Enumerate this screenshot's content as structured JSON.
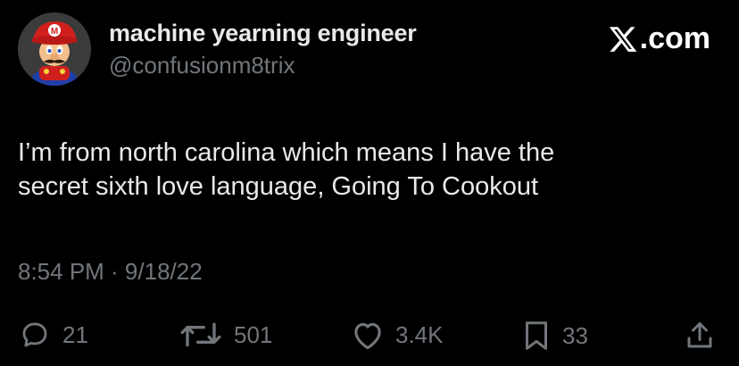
{
  "author": {
    "display_name": "machine yearning engineer",
    "handle": "@confusionm8trix",
    "avatar_icon": "mario-avatar-icon"
  },
  "brand": {
    "label": ".com",
    "icon": "x-logo-icon",
    "color": "#ffffff"
  },
  "tweet": {
    "text_lines": [
      "I’m from north carolina which means I have the",
      "secret sixth love language, Going To Cookout"
    ],
    "timestamp": "8:54 PM · 9/18/22"
  },
  "actions": {
    "reply": {
      "icon": "reply-icon",
      "count": "21"
    },
    "retweet": {
      "icon": "retweet-icon",
      "count": "501"
    },
    "like": {
      "icon": "heart-icon",
      "count": "3.4K"
    },
    "bookmark": {
      "icon": "bookmark-icon",
      "count": "33"
    },
    "share": {
      "icon": "share-icon"
    }
  },
  "colors": {
    "background": "#000000",
    "primary_text": "#e7e9ea",
    "secondary_text": "#71767b"
  }
}
